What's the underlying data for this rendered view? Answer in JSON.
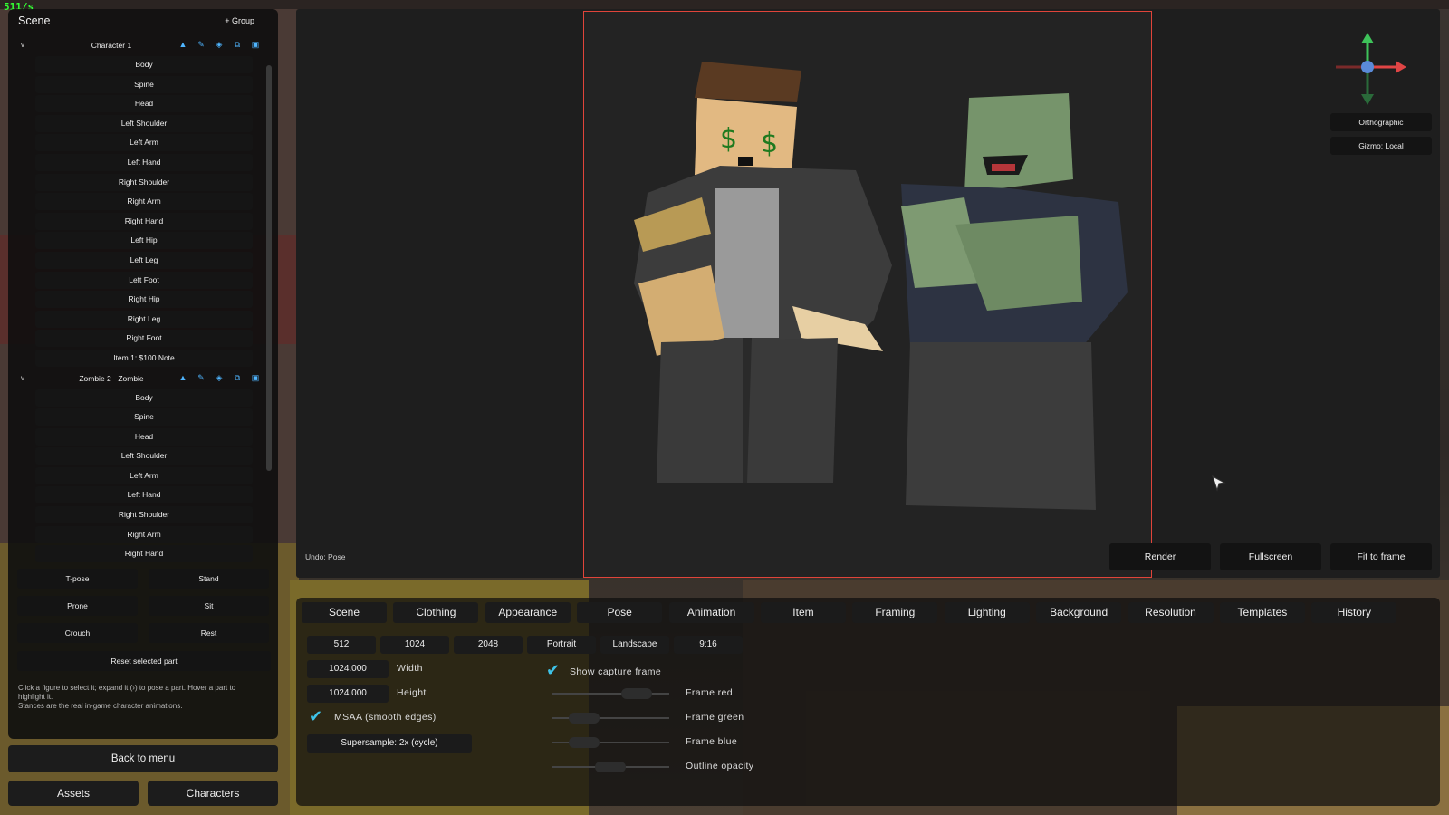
{
  "fps": "511/s",
  "scene_panel": {
    "title": "Scene",
    "add_group": "+ Group",
    "groups": [
      {
        "name": "Character 1",
        "parts": [
          "Body",
          "Spine",
          "Head",
          "Left Shoulder",
          "Left Arm",
          "Left Hand",
          "Right Shoulder",
          "Right Arm",
          "Right Hand",
          "Left Hip",
          "Left Leg",
          "Left Foot",
          "Right Hip",
          "Right Leg",
          "Right Foot",
          "Item 1: $100 Note"
        ]
      },
      {
        "name": "Zombie 2 · Zombie",
        "parts": [
          "Body",
          "Spine",
          "Head",
          "Left Shoulder",
          "Left Arm",
          "Left Hand",
          "Right Shoulder",
          "Right Arm",
          "Right Hand"
        ]
      }
    ],
    "stances": [
      "T-pose",
      "Stand",
      "Prone",
      "Sit",
      "Crouch",
      "Rest"
    ],
    "reset_label": "Reset selected part",
    "help_line1": "Click a figure to select it; expand it (›) to pose a part. Hover a part to highlight it.",
    "help_line2": "Stances are the real in-game character animations.",
    "back_to_menu": "Back to menu",
    "assets": "Assets",
    "characters": "Characters"
  },
  "viewport": {
    "undo_label": "Undo: Pose",
    "orthographic": "Orthographic",
    "gizmo_mode": "Gizmo: Local",
    "render": "Render",
    "fullscreen": "Fullscreen",
    "fit_to_frame": "Fit to frame",
    "frame_color": "#e0443a"
  },
  "bottom_panel": {
    "tabs": [
      "Scene",
      "Clothing",
      "Appearance",
      "Pose",
      "Animation",
      "Item",
      "Framing",
      "Lighting",
      "Background",
      "Resolution",
      "Templates",
      "History"
    ],
    "presets": [
      "512",
      "1024",
      "2048",
      "Portrait",
      "Landscape",
      "9:16"
    ],
    "width_value": "1024.000",
    "width_label": "Width",
    "height_value": "1024.000",
    "height_label": "Height",
    "msaa_label": "MSAA (smooth edges)",
    "supersample_label": "Supersample: 2x (cycle)",
    "show_capture_frame": "Show capture frame",
    "sliders": [
      {
        "label": "Frame red",
        "value": 0.8
      },
      {
        "label": "Frame green",
        "value": 0.2
      },
      {
        "label": "Frame blue",
        "value": 0.2
      },
      {
        "label": "Outline opacity",
        "value": 0.5
      }
    ]
  }
}
